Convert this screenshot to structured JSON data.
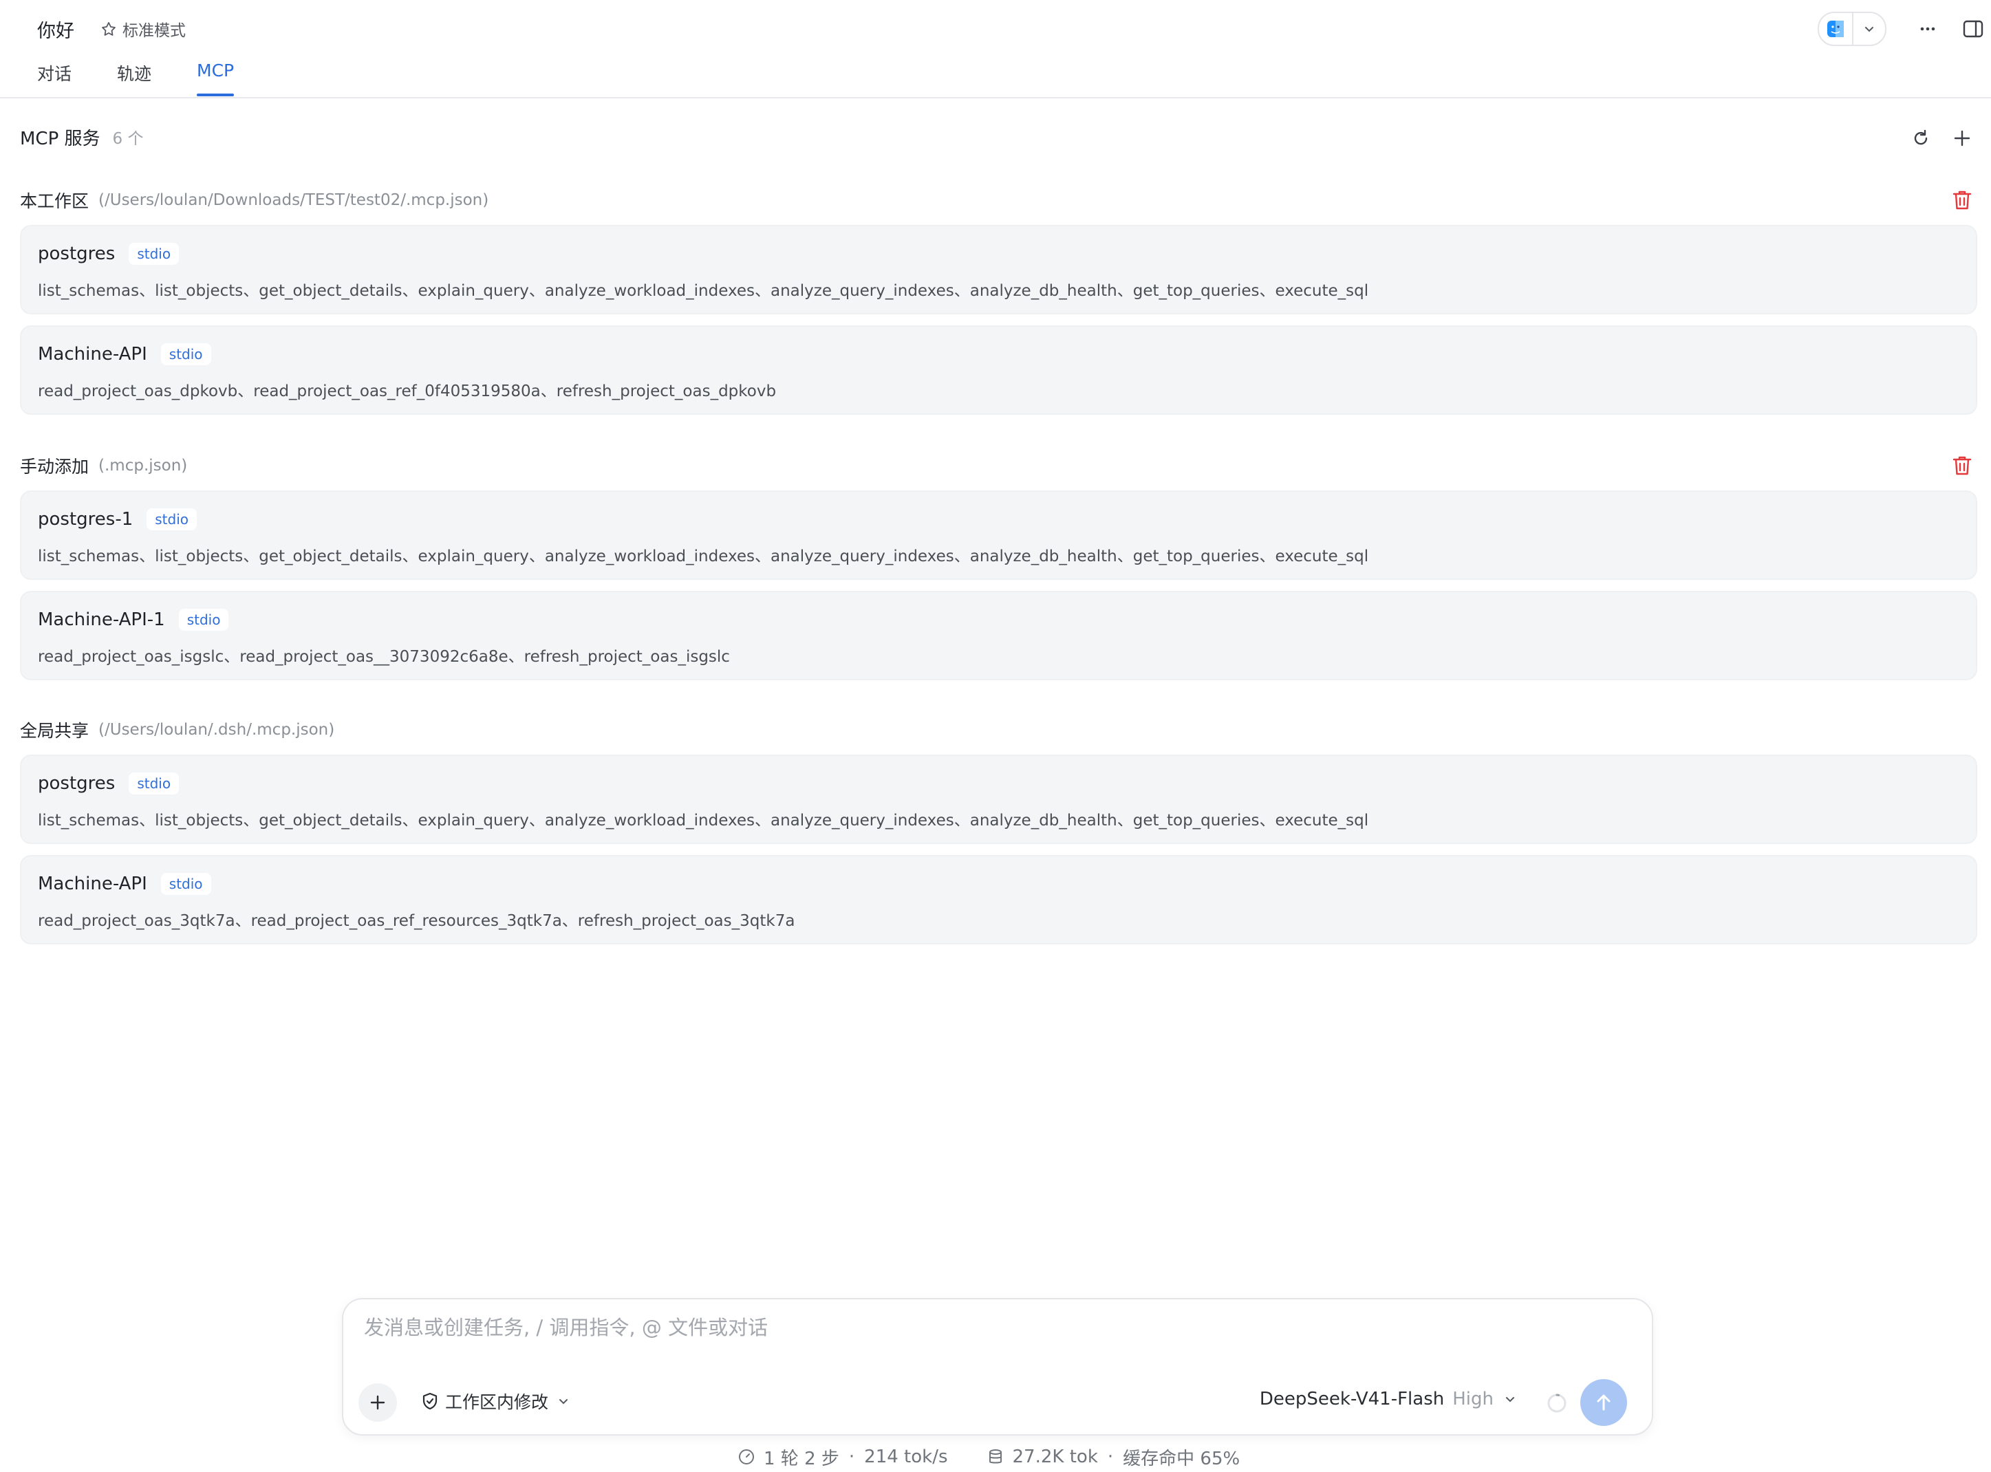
{
  "header": {
    "title": "你好",
    "mode": "标准模式",
    "tabs": [
      {
        "label": "对话",
        "active": false
      },
      {
        "label": "轨迹",
        "active": false
      },
      {
        "label": "MCP",
        "active": true
      }
    ]
  },
  "services": {
    "title": "MCP 服务",
    "count": "6 个"
  },
  "groups": [
    {
      "name": "本工作区",
      "path": "(/Users/loulan/Downloads/TEST/test02/.mcp.json)",
      "deletable": true,
      "servers": [
        {
          "name": "postgres",
          "transport": "stdio",
          "tools": "list_schemas、list_objects、get_object_details、explain_query、analyze_workload_indexes、analyze_query_indexes、analyze_db_health、get_top_queries、execute_sql"
        },
        {
          "name": "Machine-API",
          "transport": "stdio",
          "tools": "read_project_oas_dpkovb、read_project_oas_ref_0f405319580a、refresh_project_oas_dpkovb"
        }
      ]
    },
    {
      "name": "手动添加",
      "path": "(.mcp.json)",
      "deletable": true,
      "servers": [
        {
          "name": "postgres-1",
          "transport": "stdio",
          "tools": "list_schemas、list_objects、get_object_details、explain_query、analyze_workload_indexes、analyze_query_indexes、analyze_db_health、get_top_queries、execute_sql"
        },
        {
          "name": "Machine-API-1",
          "transport": "stdio",
          "tools": "read_project_oas_isgslc、read_project_oas__3073092c6a8e、refresh_project_oas_isgslc"
        }
      ]
    },
    {
      "name": "全局共享",
      "path": "(/Users/loulan/.dsh/.mcp.json)",
      "deletable": false,
      "servers": [
        {
          "name": "postgres",
          "transport": "stdio",
          "tools": "list_schemas、list_objects、get_object_details、explain_query、analyze_workload_indexes、analyze_query_indexes、analyze_db_health、get_top_queries、execute_sql"
        },
        {
          "name": "Machine-API",
          "transport": "stdio",
          "tools": "read_project_oas_3qtk7a、read_project_oas_ref_resources_3qtk7a、refresh_project_oas_3qtk7a"
        }
      ]
    }
  ],
  "composer": {
    "placeholder": "发消息或创建任务, / 调用指令, @ 文件或对话",
    "scope": "工作区内修改",
    "model": "DeepSeek-V41-Flash",
    "level": "High"
  },
  "stats": {
    "rounds": "1 轮 2 步",
    "speed": "214 tok/s",
    "tokens": "27.2K tok",
    "cache": "缓存命中 65%"
  },
  "colors": {
    "accent": "#2b6cde",
    "danger": "#e5383b",
    "card_bg": "#f4f5f7",
    "send_bg": "#a9c6f5"
  }
}
